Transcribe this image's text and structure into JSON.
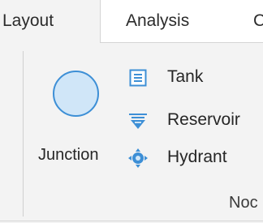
{
  "tabs": [
    {
      "label": "Layout",
      "active": true
    },
    {
      "label": "Analysis",
      "active": false
    },
    {
      "label": "C",
      "active": false
    }
  ],
  "group": {
    "label": "Noc",
    "junction_label": "Junction",
    "buttons": [
      {
        "label": "Tank",
        "icon": "tank-icon"
      },
      {
        "label": "Reservoir",
        "icon": "reservoir-icon"
      },
      {
        "label": "Hydrant",
        "icon": "hydrant-icon"
      }
    ]
  },
  "colors": {
    "accent": "#3d8fd6",
    "background": "#f3f3f3",
    "tabbar": "#ffffff"
  }
}
